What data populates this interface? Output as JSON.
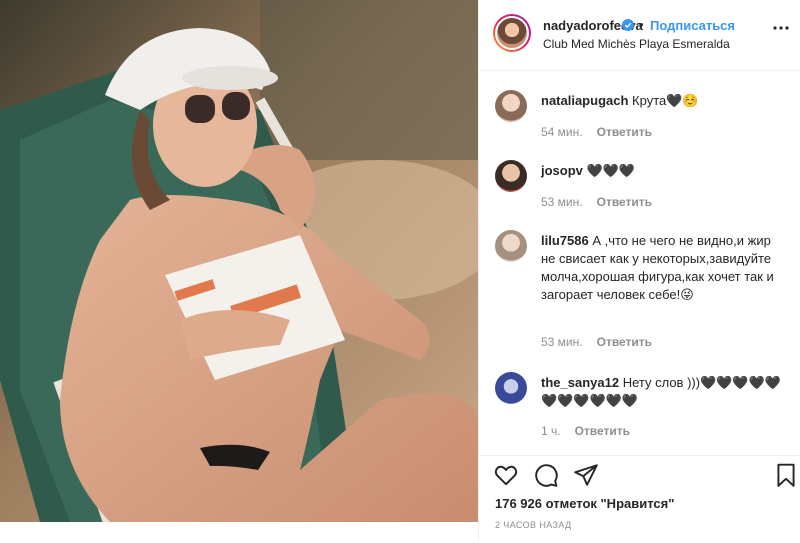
{
  "post": {
    "username": "nadyadorofeeva",
    "follow_label": "Подписаться",
    "dot": "•",
    "location": "Club Med Michès Playa Esmeralda",
    "likes_text": "176 926 отметок \"Нравится\"",
    "time_ago": "2 ЧАСОВ НАЗАД"
  },
  "comments": [
    {
      "user": "nataliapugach",
      "text": "Крута🖤☺️",
      "time": "54 мин.",
      "reply": "Ответить"
    },
    {
      "user": "josopv",
      "text": "🖤🖤🖤",
      "time": "53 мин.",
      "reply": "Ответить"
    },
    {
      "user": "lilu7586",
      "text": "А ,что не чего не видно,и жир не свисает как у некоторых,завидуйте молча,хорошая фигура,как хочет так и загорает человек себе!😜",
      "time": "53 мин.",
      "reply": "Ответить"
    },
    {
      "user": "the_sanya12",
      "text": "Нету слов )))🖤🖤🖤🖤🖤🖤🖤🖤🖤🖤🖤",
      "time": "1 ч.",
      "reply": "Ответить"
    }
  ],
  "colors": {
    "accent": "#3897f0",
    "muted": "#8e8e8e",
    "text": "#262626"
  },
  "icons": [
    "verified-icon",
    "more-options-icon",
    "heart-icon",
    "comment-icon",
    "share-icon",
    "bookmark-icon"
  ]
}
